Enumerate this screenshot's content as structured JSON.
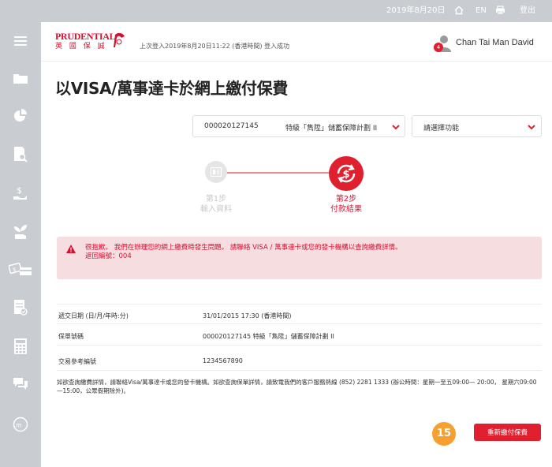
{
  "topbar": {
    "date": "2019年8月20日",
    "language": "EN",
    "logout": "登出",
    "icons": [
      "home-icon",
      "print-icon"
    ]
  },
  "sidebar": {
    "icons": [
      "menu-icon",
      "folder-icon",
      "pie-chart-icon",
      "search-document-icon",
      "money-hand-icon",
      "plant-growth-icon",
      "payment-card-icon",
      "checklist-icon",
      "calculator-icon",
      "chat-icon",
      "my-logo-icon"
    ]
  },
  "header": {
    "logo_top": "PRUDENTIAL",
    "logo_bottom": "英 國 保 誠",
    "last_login": "上次登入2019年8月20日11:22 (香港時間) 登入成功",
    "notification_count": "4",
    "user_name": "Chan Tai Man David"
  },
  "page": {
    "title": "以VISA/萬事達卡於網上繳付保費"
  },
  "selectors": {
    "policy_number": "000020127145",
    "policy_plan": "特級「雋陞」儲蓄保障計劃 II",
    "function_placeholder": "請選擇功能"
  },
  "stepper": {
    "step1_title": "第1步",
    "step1_name": "輸入資料",
    "step2_title": "第2步",
    "step2_name": "付款結果"
  },
  "alert": {
    "line1": "很抱歉。 我們在辦理您的網上繳費時發生問題。 請聯絡 VISA / 萬事達卡或您的發卡機構以查詢繳費詳情。",
    "line2": "返回編號：004"
  },
  "info_rows": [
    {
      "label": "遞交日期 (日/月/年時:分)",
      "value": "31/01/2015 17:30 (香港時間)"
    },
    {
      "label": "保單號碼",
      "value": "000020127145 特級「雋陞」儲蓄保障計劃 II"
    },
    {
      "label": "交易參考編號",
      "value": "1234567890"
    }
  ],
  "note": "如欲查詢繳費詳情，請聯絡Visa/萬事達卡或您的發卡機構。如欲查詢保單詳情，請致電我們的客戶服務熱線 (852) 2281 1333 (辦公時間：星期一至五09:00— 20:00， 星期六09:00—15:00，公眾假期除外)。",
  "actions": {
    "step_marker": "15",
    "resubmit_label": "重新繳付保費"
  },
  "colors": {
    "brand_red": "#e0202f",
    "alert_bg": "#f6dde0",
    "sidebar_bg": "#c9cdd2",
    "marker_orange": "#f5a030"
  }
}
